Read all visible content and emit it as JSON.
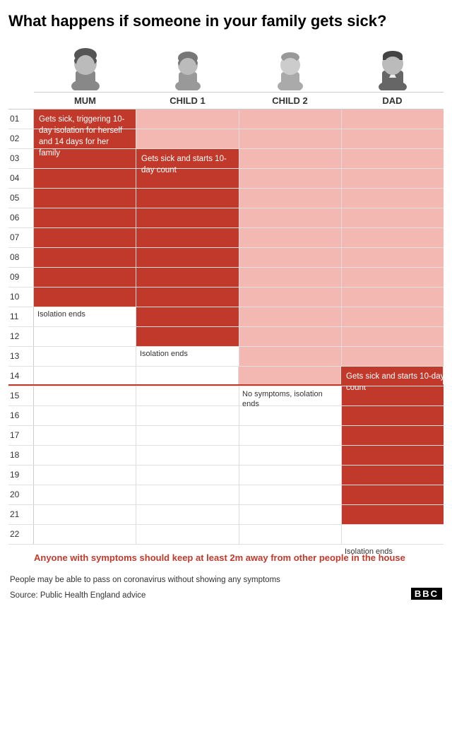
{
  "headline": "What happens if someone in your family gets sick?",
  "columns": [
    {
      "id": "mum",
      "label": "MUM",
      "avatar_type": "woman_dark"
    },
    {
      "id": "child1",
      "label": "CHILD 1",
      "avatar_type": "girl"
    },
    {
      "id": "child2",
      "label": "CHILD 2",
      "avatar_type": "boy_light"
    },
    {
      "id": "dad",
      "label": "DAD",
      "avatar_type": "man_dark"
    }
  ],
  "days": [
    "01",
    "02",
    "03",
    "04",
    "05",
    "06",
    "07",
    "08",
    "09",
    "10",
    "11",
    "12",
    "13",
    "14",
    "15",
    "16",
    "17",
    "18",
    "19",
    "20",
    "21",
    "22"
  ],
  "annotations": {
    "mum_sick": "Gets sick, triggering 10-day isolation for herself and 14 days for her family",
    "child1_sick": "Gets sick and starts 10-day count",
    "mum_isolation_ends": "Isolation ends",
    "child1_isolation_ends": "Isolation ends",
    "child2_no_symptoms": "No symptoms, isolation ends",
    "dad_sick": "Gets sick and starts 10-day count",
    "dad_isolation_ends": "Isolation ends",
    "warning": "Anyone with symptoms should keep at least 2m away from other people in the house"
  },
  "footer": {
    "disclaimer": "People may be able to pass on coronavirus without showing any symptoms",
    "source": "Source: Public Health England advice",
    "bbc": "BBC"
  }
}
